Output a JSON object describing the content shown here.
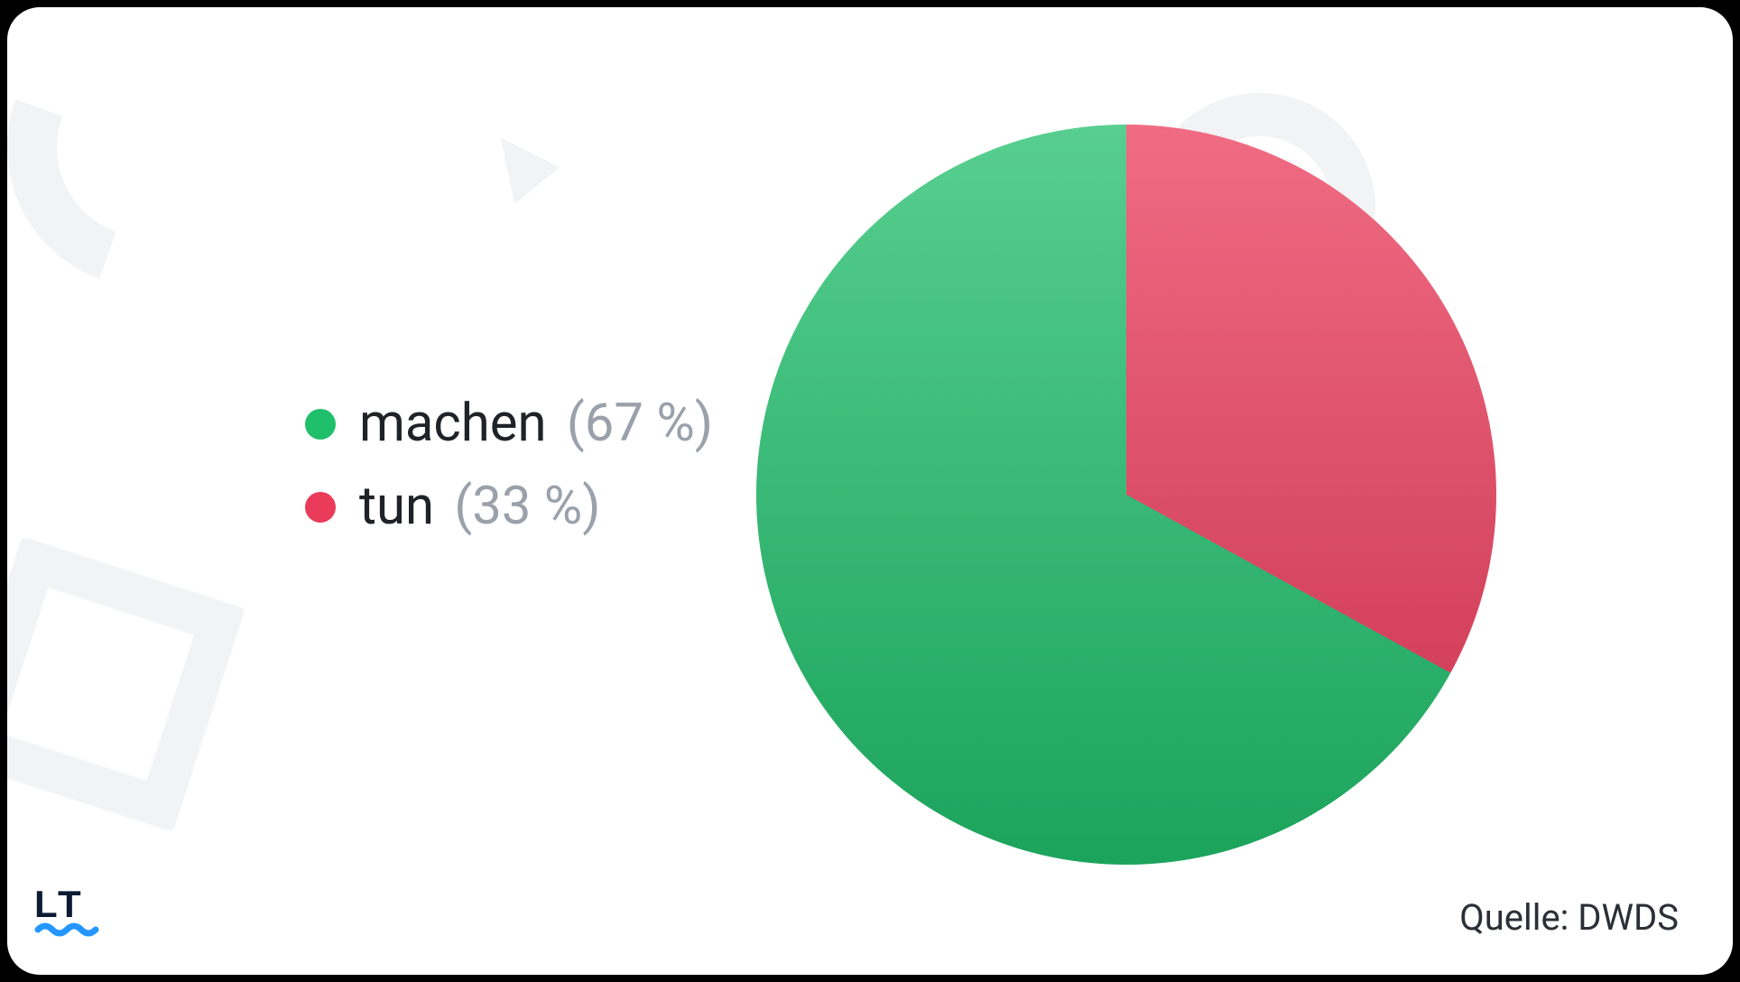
{
  "chart_data": {
    "type": "pie",
    "series": [
      {
        "name": "machen",
        "value": 67,
        "color": "#20bf6b"
      },
      {
        "name": "tun",
        "value": 33,
        "color": "#eb3b5a"
      }
    ]
  },
  "legend": {
    "items": [
      {
        "label": "machen",
        "pct_text": "(67 %)",
        "color": "#20bf6b"
      },
      {
        "label": "tun",
        "pct_text": "(33 %)",
        "color": "#eb3b5a"
      }
    ]
  },
  "source_text": "Quelle: DWDS",
  "logo": {
    "letters": "LT"
  }
}
